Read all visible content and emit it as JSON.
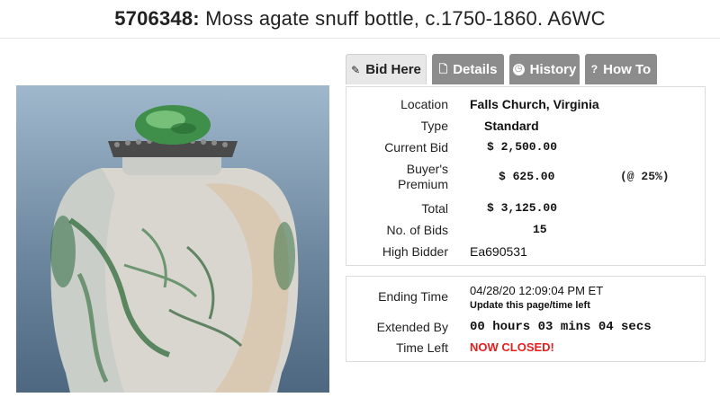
{
  "header": {
    "lot_number": "5706348:",
    "title": "Moss agate snuff bottle, c.1750-1860. A6WC"
  },
  "tabs": [
    {
      "label": "Bid Here",
      "icon": "pencil-icon",
      "glyph": "✎"
    },
    {
      "label": "Details",
      "icon": "document-icon",
      "glyph": "🗋"
    },
    {
      "label": "History",
      "icon": "clock-icon",
      "glyph": "◷"
    },
    {
      "label": "How To",
      "icon": "question-icon",
      "glyph": "?"
    }
  ],
  "bid_info": {
    "location": {
      "label": "Location",
      "value": "Falls Church, Virginia"
    },
    "type": {
      "label": "Type",
      "value": "Standard"
    },
    "current_bid": {
      "label": "Current Bid",
      "value": "$ 2,500.00"
    },
    "buyers_premium": {
      "label_line1": "Buyer's",
      "label_line2": "Premium",
      "value": "$ 625.00",
      "rate": "(@ 25%)"
    },
    "total": {
      "label": "Total",
      "value": "$ 3,125.00"
    },
    "num_bids": {
      "label": "No. of Bids",
      "value": "15"
    },
    "high_bidder": {
      "label": "High Bidder",
      "value": "Ea690531"
    }
  },
  "timing": {
    "ending_time": {
      "label": "Ending Time",
      "value": "04/28/20 12:09:04 PM ET",
      "note": "Update this page/time left"
    },
    "extended_by": {
      "label": "Extended By",
      "value": "00 hours 03 mins 04 secs"
    },
    "time_left": {
      "label": "Time Left",
      "value": "NOW CLOSED!"
    }
  },
  "colors": {
    "closed": "#e32020",
    "tab_inactive": "#8c8c8c",
    "tab_active": "#e8e8e8"
  }
}
